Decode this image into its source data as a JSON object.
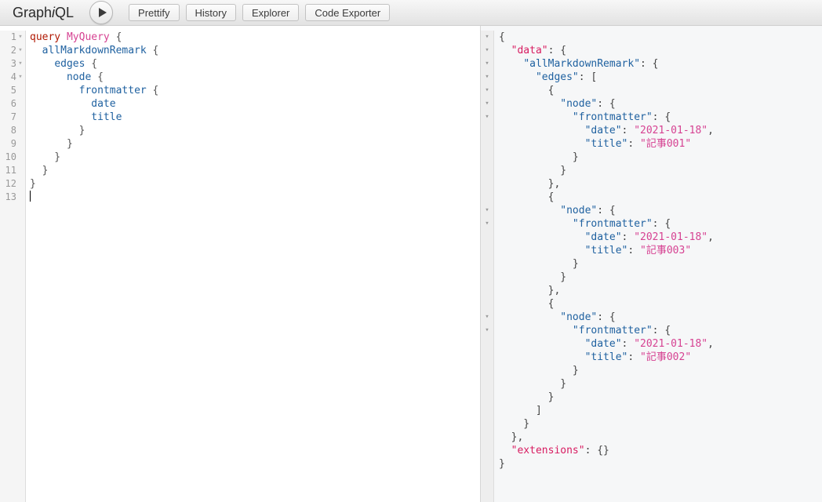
{
  "app": {
    "logo_left": "Graph",
    "logo_italic": "i",
    "logo_right": "QL"
  },
  "topbar": {
    "execute_label": "▶",
    "buttons": [
      {
        "label": "Prettify",
        "name": "prettify-button"
      },
      {
        "label": "History",
        "name": "history-button"
      },
      {
        "label": "Explorer",
        "name": "explorer-button"
      },
      {
        "label": "Code Exporter",
        "name": "code-exporter-button"
      }
    ]
  },
  "editor": {
    "line_numbers": [
      "1",
      "2",
      "3",
      "4",
      "5",
      "6",
      "7",
      "8",
      "9",
      "10",
      "11",
      "12",
      "13"
    ],
    "fold_lines": [
      1,
      2,
      3,
      4
    ],
    "fold_glyph": "▾",
    "lines": [
      [
        {
          "t": "keyword",
          "v": "query"
        },
        {
          "t": "punct",
          "v": " "
        },
        {
          "t": "def",
          "v": "MyQuery"
        },
        {
          "t": "punct",
          "v": " {"
        }
      ],
      [
        {
          "t": "punct",
          "v": "  "
        },
        {
          "t": "prop",
          "v": "allMarkdownRemark"
        },
        {
          "t": "punct",
          "v": " {"
        }
      ],
      [
        {
          "t": "punct",
          "v": "    "
        },
        {
          "t": "prop",
          "v": "edges"
        },
        {
          "t": "punct",
          "v": " {"
        }
      ],
      [
        {
          "t": "punct",
          "v": "      "
        },
        {
          "t": "prop",
          "v": "node"
        },
        {
          "t": "punct",
          "v": " {"
        }
      ],
      [
        {
          "t": "punct",
          "v": "        "
        },
        {
          "t": "prop",
          "v": "frontmatter"
        },
        {
          "t": "punct",
          "v": " {"
        }
      ],
      [
        {
          "t": "punct",
          "v": "          "
        },
        {
          "t": "prop",
          "v": "date"
        }
      ],
      [
        {
          "t": "punct",
          "v": "          "
        },
        {
          "t": "prop",
          "v": "title"
        }
      ],
      [
        {
          "t": "punct",
          "v": "        }"
        }
      ],
      [
        {
          "t": "punct",
          "v": "      }"
        }
      ],
      [
        {
          "t": "punct",
          "v": "    }"
        }
      ],
      [
        {
          "t": "punct",
          "v": "  }"
        }
      ],
      [
        {
          "t": "punct",
          "v": "}"
        }
      ],
      [
        {
          "t": "caret",
          "v": ""
        }
      ]
    ]
  },
  "result": {
    "fold_glyph": "▾",
    "fold_lines": [
      1,
      2,
      3,
      4,
      5,
      6,
      7,
      14,
      15,
      22,
      23
    ],
    "lines": [
      [
        {
          "t": "brace",
          "v": "{"
        }
      ],
      [
        {
          "t": "brace",
          "v": "  "
        },
        {
          "t": "rootkey",
          "v": "\"data\""
        },
        {
          "t": "brace",
          "v": ": {"
        }
      ],
      [
        {
          "t": "brace",
          "v": "    "
        },
        {
          "t": "key",
          "v": "\"allMarkdownRemark\""
        },
        {
          "t": "brace",
          "v": ": {"
        }
      ],
      [
        {
          "t": "brace",
          "v": "      "
        },
        {
          "t": "key",
          "v": "\"edges\""
        },
        {
          "t": "brace",
          "v": ": ["
        }
      ],
      [
        {
          "t": "brace",
          "v": "        {"
        }
      ],
      [
        {
          "t": "brace",
          "v": "          "
        },
        {
          "t": "key",
          "v": "\"node\""
        },
        {
          "t": "brace",
          "v": ": {"
        }
      ],
      [
        {
          "t": "brace",
          "v": "            "
        },
        {
          "t": "key",
          "v": "\"frontmatter\""
        },
        {
          "t": "brace",
          "v": ": {"
        }
      ],
      [
        {
          "t": "brace",
          "v": "              "
        },
        {
          "t": "key",
          "v": "\"date\""
        },
        {
          "t": "brace",
          "v": ": "
        },
        {
          "t": "string",
          "v": "\"2021-01-18\""
        },
        {
          "t": "brace",
          "v": ","
        }
      ],
      [
        {
          "t": "brace",
          "v": "              "
        },
        {
          "t": "key",
          "v": "\"title\""
        },
        {
          "t": "brace",
          "v": ": "
        },
        {
          "t": "string",
          "v": "\"記事001\""
        }
      ],
      [
        {
          "t": "brace",
          "v": "            }"
        }
      ],
      [
        {
          "t": "brace",
          "v": "          }"
        }
      ],
      [
        {
          "t": "brace",
          "v": "        },"
        }
      ],
      [
        {
          "t": "brace",
          "v": "        {"
        }
      ],
      [
        {
          "t": "brace",
          "v": "          "
        },
        {
          "t": "key",
          "v": "\"node\""
        },
        {
          "t": "brace",
          "v": ": {"
        }
      ],
      [
        {
          "t": "brace",
          "v": "            "
        },
        {
          "t": "key",
          "v": "\"frontmatter\""
        },
        {
          "t": "brace",
          "v": ": {"
        }
      ],
      [
        {
          "t": "brace",
          "v": "              "
        },
        {
          "t": "key",
          "v": "\"date\""
        },
        {
          "t": "brace",
          "v": ": "
        },
        {
          "t": "string",
          "v": "\"2021-01-18\""
        },
        {
          "t": "brace",
          "v": ","
        }
      ],
      [
        {
          "t": "brace",
          "v": "              "
        },
        {
          "t": "key",
          "v": "\"title\""
        },
        {
          "t": "brace",
          "v": ": "
        },
        {
          "t": "string",
          "v": "\"記事003\""
        }
      ],
      [
        {
          "t": "brace",
          "v": "            }"
        }
      ],
      [
        {
          "t": "brace",
          "v": "          }"
        }
      ],
      [
        {
          "t": "brace",
          "v": "        },"
        }
      ],
      [
        {
          "t": "brace",
          "v": "        {"
        }
      ],
      [
        {
          "t": "brace",
          "v": "          "
        },
        {
          "t": "key",
          "v": "\"node\""
        },
        {
          "t": "brace",
          "v": ": {"
        }
      ],
      [
        {
          "t": "brace",
          "v": "            "
        },
        {
          "t": "key",
          "v": "\"frontmatter\""
        },
        {
          "t": "brace",
          "v": ": {"
        }
      ],
      [
        {
          "t": "brace",
          "v": "              "
        },
        {
          "t": "key",
          "v": "\"date\""
        },
        {
          "t": "brace",
          "v": ": "
        },
        {
          "t": "string",
          "v": "\"2021-01-18\""
        },
        {
          "t": "brace",
          "v": ","
        }
      ],
      [
        {
          "t": "brace",
          "v": "              "
        },
        {
          "t": "key",
          "v": "\"title\""
        },
        {
          "t": "brace",
          "v": ": "
        },
        {
          "t": "string",
          "v": "\"記事002\""
        }
      ],
      [
        {
          "t": "brace",
          "v": "            }"
        }
      ],
      [
        {
          "t": "brace",
          "v": "          }"
        }
      ],
      [
        {
          "t": "brace",
          "v": "        }"
        }
      ],
      [
        {
          "t": "brace",
          "v": "      ]"
        }
      ],
      [
        {
          "t": "brace",
          "v": "    }"
        }
      ],
      [
        {
          "t": "brace",
          "v": "  },"
        }
      ],
      [
        {
          "t": "brace",
          "v": "  "
        },
        {
          "t": "rootkey",
          "v": "\"extensions\""
        },
        {
          "t": "brace",
          "v": ": {}"
        }
      ],
      [
        {
          "t": "brace",
          "v": "}"
        }
      ]
    ]
  },
  "colors": {
    "keyword": "#b11a04",
    "definition": "#d64292",
    "property": "#1f61a0",
    "json_root_key": "#d81b60",
    "json_key": "#1f61a0",
    "json_string": "#d64292",
    "result_bg": "#f6f7f8",
    "editor_bg": "#ffffff",
    "topbar_bg": "#e9e9e9"
  }
}
